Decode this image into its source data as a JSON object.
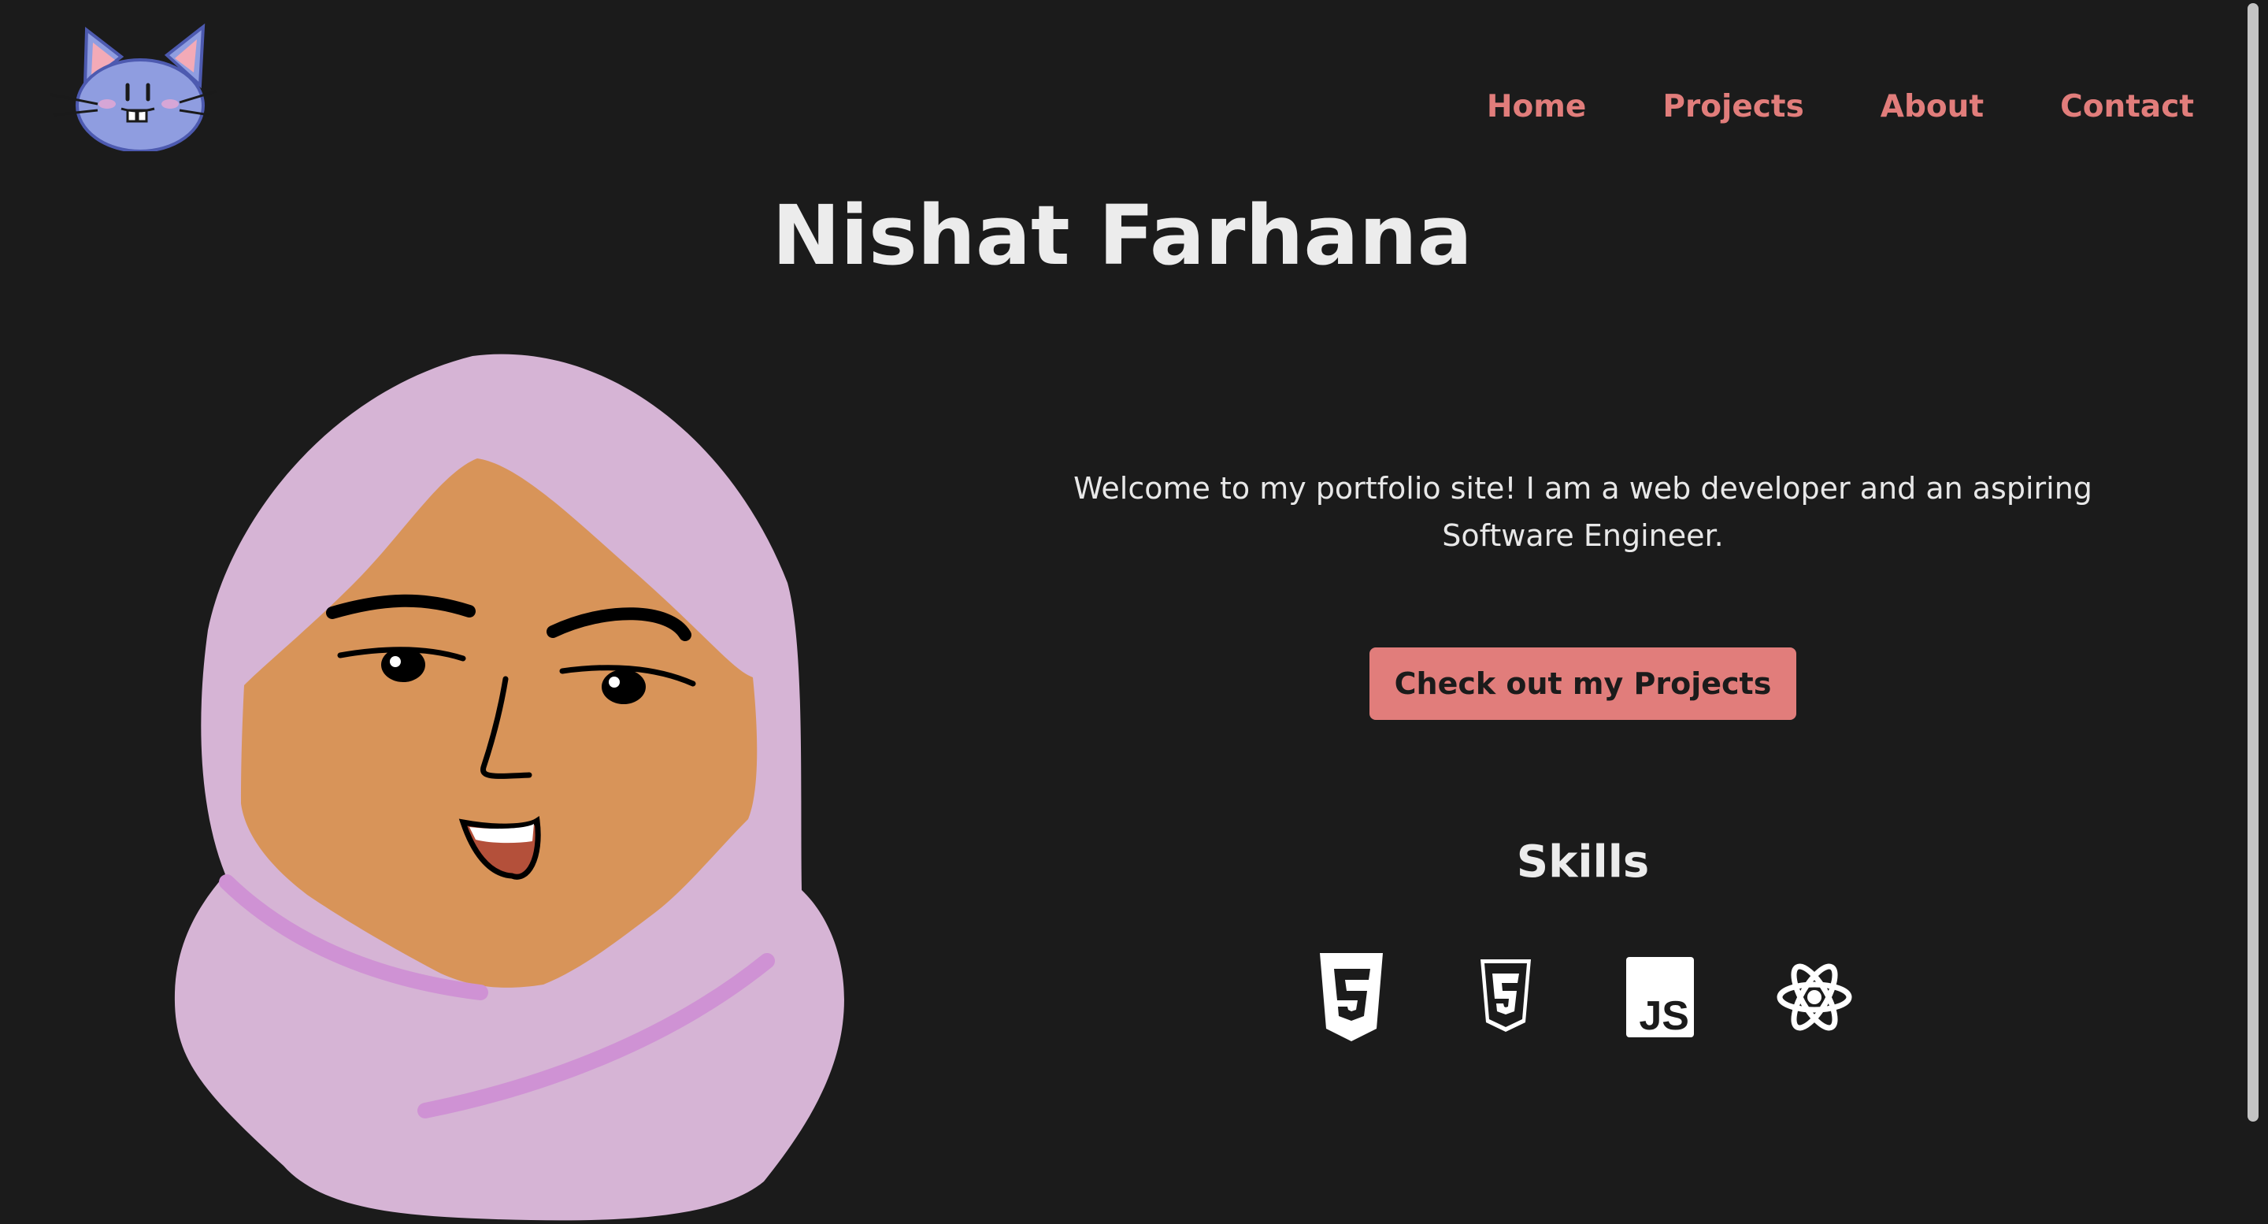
{
  "header": {
    "logo_icon": "cat-face-icon",
    "nav": [
      {
        "label": "Home"
      },
      {
        "label": "Projects"
      },
      {
        "label": "About"
      },
      {
        "label": "Contact"
      }
    ]
  },
  "hero": {
    "name": "Nishat Farhana",
    "avatar_icon": "hijab-avatar-illustration",
    "intro": "Welcome to my portfolio site! I am a web developer and an aspiring Software Engineer.",
    "cta_label": "Check out my Projects"
  },
  "skills": {
    "title": "Skills",
    "items": [
      {
        "icon": "html5-icon"
      },
      {
        "icon": "css3-icon"
      },
      {
        "icon": "javascript-icon"
      },
      {
        "icon": "react-icon"
      }
    ]
  },
  "colors": {
    "background": "#1b1b1b",
    "accent": "#e17d7b",
    "text": "#ececec",
    "hijab": "#d6b4d5",
    "skin": "#d89459",
    "logo_blue": "#8f9de0"
  }
}
